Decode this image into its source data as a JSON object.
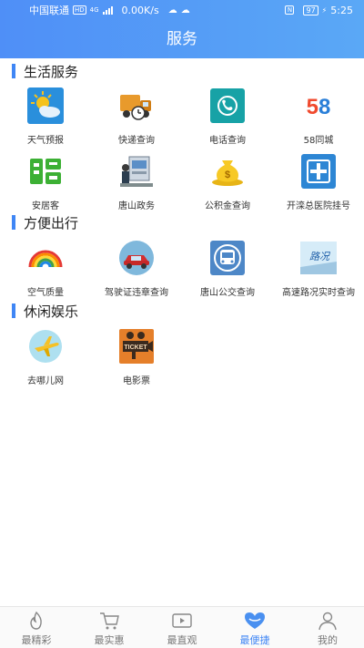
{
  "status_bar": {
    "carrier": "中国联通",
    "network": "4G",
    "hd": "HD",
    "speed": "0.00K/s",
    "battery": "97",
    "time": "5:25"
  },
  "header": {
    "title": "服务"
  },
  "sections": [
    {
      "title": "生活服务",
      "items": [
        {
          "label": "天气预报",
          "icon": "weather-icon"
        },
        {
          "label": "快递查询",
          "icon": "delivery-truck-icon"
        },
        {
          "label": "电话查询",
          "icon": "phone-icon"
        },
        {
          "label": "58同城",
          "icon": "58-logo-icon",
          "logo_text": "58"
        },
        {
          "label": "安居客",
          "icon": "anjuke-logo-icon"
        },
        {
          "label": "唐山政务",
          "icon": "government-icon"
        },
        {
          "label": "公积金查询",
          "icon": "money-bag-icon"
        },
        {
          "label": "开滦总医院挂号",
          "icon": "hospital-icon"
        }
      ]
    },
    {
      "title": "方便出行",
      "items": [
        {
          "label": "空气质量",
          "icon": "rainbow-icon"
        },
        {
          "label": "驾驶证违章查询",
          "icon": "car-icon"
        },
        {
          "label": "唐山公交查询",
          "icon": "bus-icon"
        },
        {
          "label": "高速路况实时查询",
          "icon": "road-icon",
          "logo_text": "路况"
        }
      ]
    },
    {
      "title": "休闲娱乐",
      "items": [
        {
          "label": "去哪儿网",
          "icon": "plane-icon"
        },
        {
          "label": "电影票",
          "icon": "movie-ticket-icon",
          "logo_text": "TICKET"
        }
      ]
    }
  ],
  "tabbar": [
    {
      "label": "最精彩",
      "icon": "flame-icon",
      "active": false
    },
    {
      "label": "最实惠",
      "icon": "cart-icon",
      "active": false
    },
    {
      "label": "最直观",
      "icon": "video-icon",
      "active": false
    },
    {
      "label": "最便捷",
      "icon": "heart-icon",
      "active": true
    },
    {
      "label": "我的",
      "icon": "user-icon",
      "active": false
    }
  ],
  "colors": {
    "accent": "#3f86f5",
    "header_gradient_start": "#4f8ff7",
    "header_gradient_end": "#5aa8f6"
  }
}
